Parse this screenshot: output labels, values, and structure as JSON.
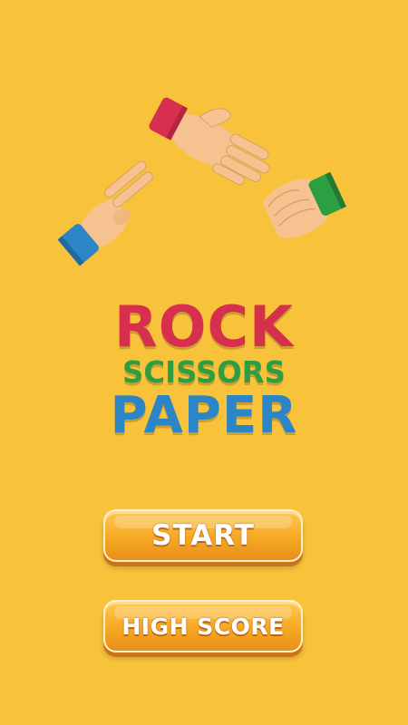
{
  "title": {
    "line1": "ROCK",
    "line2": "SCISSORS",
    "line3": "PAPER"
  },
  "buttons": {
    "start": "START",
    "high_score": "HIGH SCORE"
  },
  "colors": {
    "background": "#f8c23a",
    "rock": "#d6304e",
    "scissors": "#2e9e43",
    "paper": "#2b85c6",
    "button": "#f6a823"
  },
  "icons": [
    "paper-hand-icon",
    "scissors-hand-icon",
    "rock-fist-icon"
  ]
}
